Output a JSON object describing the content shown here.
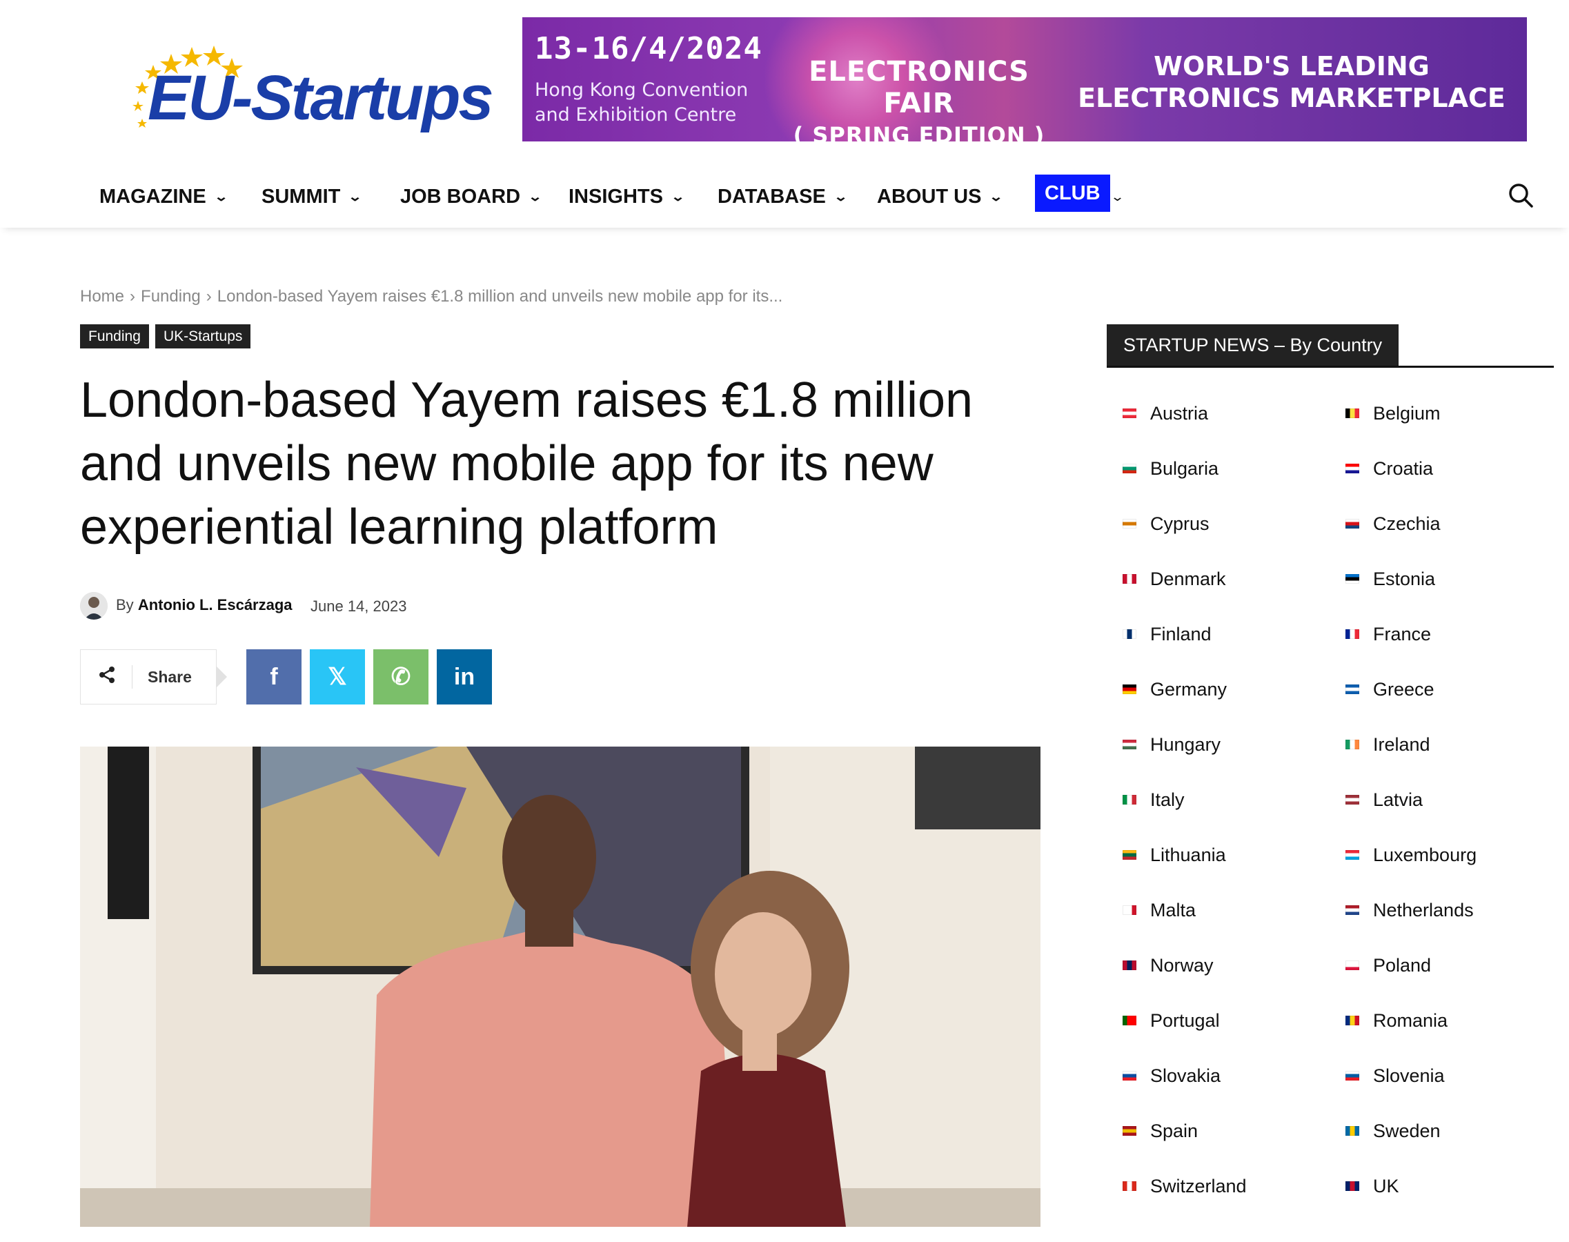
{
  "header": {
    "logo_text": "EU-Startups",
    "banner": {
      "date": "13-16/4/2024",
      "venue_line1": "Hong Kong Convention",
      "venue_line2": "and Exhibition Centre",
      "fair_title": "ELECTRONICS FAIR",
      "fair_edition": "( SPRING EDITION )",
      "tagline_line1": "WORLD'S LEADING",
      "tagline_line2": "ELECTRONICS MARKETPLACE"
    }
  },
  "nav": {
    "items": [
      "MAGAZINE",
      "SUMMIT",
      "JOB BOARD",
      "INSIGHTS",
      "DATABASE",
      "ABOUT US"
    ],
    "club_label": "CLUB",
    "chevron": "⌄",
    "search_icon": "search-icon"
  },
  "article": {
    "breadcrumb": [
      "Home",
      "Funding",
      "London-based Yayem raises €1.8 million and unveils new mobile app for its..."
    ],
    "breadcrumb_sep": "›",
    "categories": [
      "Funding",
      "UK-Startups"
    ],
    "title": "London-based Yayem raises €1.8 million and unveils new mobile app for its new experiential learning platform",
    "author_prefix": "By",
    "author": "Antonio L. Escárzaga",
    "date": "June 14, 2023",
    "share_label": "Share",
    "share_buttons": [
      {
        "name": "facebook",
        "glyph": "f",
        "color": "#516eab"
      },
      {
        "name": "x",
        "glyph": "𝕏",
        "color": "#29c5f6"
      },
      {
        "name": "whatsapp",
        "glyph": "✆",
        "color": "#7bbf6a"
      },
      {
        "name": "linkedin",
        "glyph": "in",
        "color": "#0266a0"
      }
    ]
  },
  "sidebar": {
    "heading": "STARTUP NEWS – By Country",
    "countries": [
      {
        "name": "Austria",
        "flag": [
          "#ed2939",
          "#ffffff",
          "#ed2939"
        ],
        "dir": "h"
      },
      {
        "name": "Belgium",
        "flag": [
          "#000000",
          "#fae042",
          "#ed2939"
        ],
        "dir": "v"
      },
      {
        "name": "Bulgaria",
        "flag": [
          "#ffffff",
          "#00966e",
          "#d62612"
        ],
        "dir": "h"
      },
      {
        "name": "Croatia",
        "flag": [
          "#ff0000",
          "#ffffff",
          "#171796"
        ],
        "dir": "h"
      },
      {
        "name": "Cyprus",
        "flag": [
          "#ffffff",
          "#d57800",
          "#ffffff"
        ],
        "dir": "h"
      },
      {
        "name": "Czechia",
        "flag": [
          "#ffffff",
          "#d7141a",
          "#11457e"
        ],
        "dir": "h"
      },
      {
        "name": "Denmark",
        "flag": [
          "#c8102e",
          "#ffffff",
          "#c8102e"
        ],
        "dir": "v"
      },
      {
        "name": "Estonia",
        "flag": [
          "#0072ce",
          "#000000",
          "#ffffff"
        ],
        "dir": "h"
      },
      {
        "name": "Finland",
        "flag": [
          "#ffffff",
          "#002f6c",
          "#ffffff"
        ],
        "dir": "v"
      },
      {
        "name": "France",
        "flag": [
          "#002395",
          "#ffffff",
          "#ed2939"
        ],
        "dir": "v"
      },
      {
        "name": "Germany",
        "flag": [
          "#000000",
          "#dd0000",
          "#ffce00"
        ],
        "dir": "h"
      },
      {
        "name": "Greece",
        "flag": [
          "#0d5eaf",
          "#ffffff",
          "#0d5eaf"
        ],
        "dir": "h"
      },
      {
        "name": "Hungary",
        "flag": [
          "#cd2a3e",
          "#ffffff",
          "#436f4d"
        ],
        "dir": "h"
      },
      {
        "name": "Ireland",
        "flag": [
          "#169b62",
          "#ffffff",
          "#ff883e"
        ],
        "dir": "v"
      },
      {
        "name": "Italy",
        "flag": [
          "#009246",
          "#ffffff",
          "#ce2b37"
        ],
        "dir": "v"
      },
      {
        "name": "Latvia",
        "flag": [
          "#9e3039",
          "#ffffff",
          "#9e3039"
        ],
        "dir": "h"
      },
      {
        "name": "Lithuania",
        "flag": [
          "#fdb913",
          "#006a44",
          "#c1272d"
        ],
        "dir": "h"
      },
      {
        "name": "Luxembourg",
        "flag": [
          "#ed2939",
          "#ffffff",
          "#00a1de"
        ],
        "dir": "h"
      },
      {
        "name": "Malta",
        "flag": [
          "#ffffff",
          "#ffffff",
          "#cf142b"
        ],
        "dir": "v"
      },
      {
        "name": "Netherlands",
        "flag": [
          "#ae1c28",
          "#ffffff",
          "#21468b"
        ],
        "dir": "h"
      },
      {
        "name": "Norway",
        "flag": [
          "#ba0c2f",
          "#00205b",
          "#ba0c2f"
        ],
        "dir": "v"
      },
      {
        "name": "Poland",
        "flag": [
          "#ffffff",
          "#ffffff",
          "#dc143c"
        ],
        "dir": "h"
      },
      {
        "name": "Portugal",
        "flag": [
          "#006600",
          "#ff0000",
          "#ff0000"
        ],
        "dir": "v"
      },
      {
        "name": "Romania",
        "flag": [
          "#002b7f",
          "#fcd116",
          "#ce1126"
        ],
        "dir": "v"
      },
      {
        "name": "Slovakia",
        "flag": [
          "#ffffff",
          "#0b4ea2",
          "#ee1c25"
        ],
        "dir": "h"
      },
      {
        "name": "Slovenia",
        "flag": [
          "#ffffff",
          "#005da4",
          "#ed1c24"
        ],
        "dir": "h"
      },
      {
        "name": "Spain",
        "flag": [
          "#aa151b",
          "#f1bf00",
          "#aa151b"
        ],
        "dir": "h"
      },
      {
        "name": "Sweden",
        "flag": [
          "#006aa7",
          "#fecc00",
          "#006aa7"
        ],
        "dir": "v"
      },
      {
        "name": "Switzerland",
        "flag": [
          "#da291c",
          "#ffffff",
          "#da291c"
        ],
        "dir": "v"
      },
      {
        "name": "UK",
        "flag": [
          "#012169",
          "#c8102e",
          "#012169"
        ],
        "dir": "v"
      }
    ]
  }
}
